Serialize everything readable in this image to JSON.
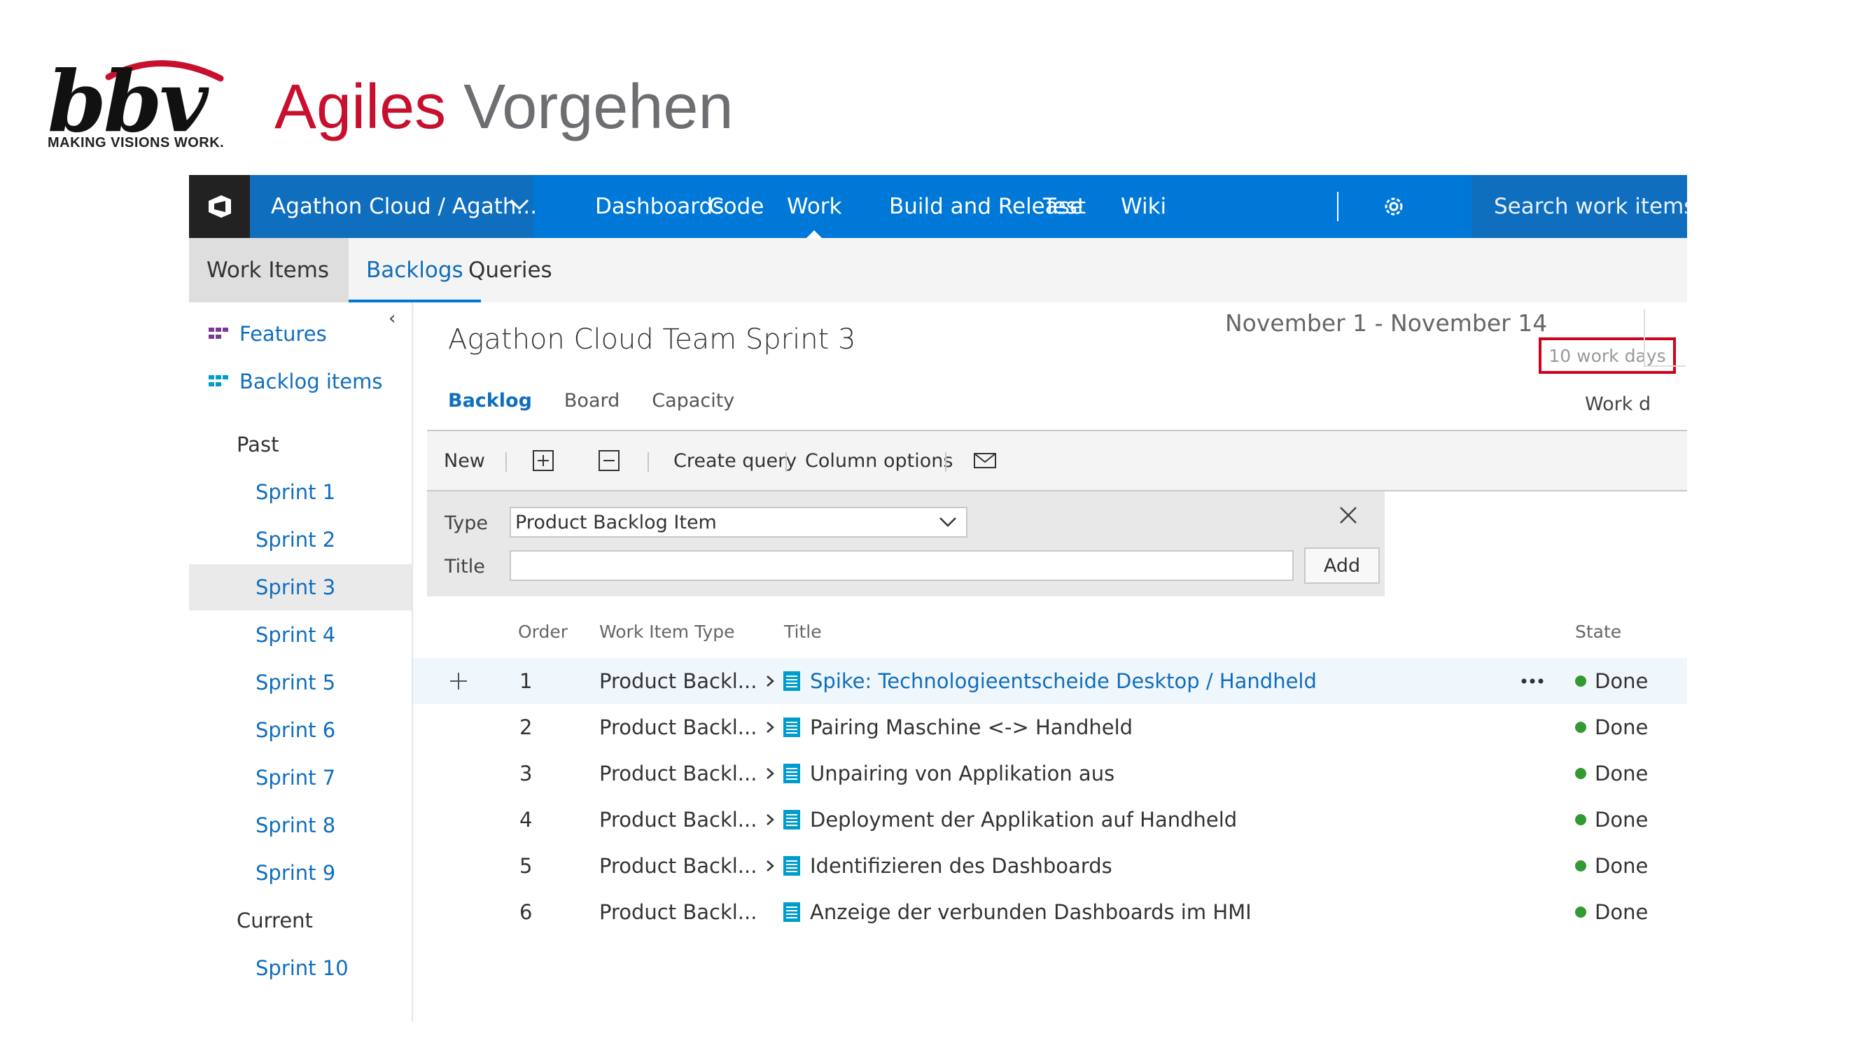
{
  "slide": {
    "logo": {
      "word": "bbv",
      "tagline": "MAKING VISIONS WORK.",
      "arc_color": "#c8102e"
    },
    "title_part1": "Agiles",
    "title_part2": "Vorgehen",
    "title_color1": "#c8102e",
    "title_color2": "#6d6e71"
  },
  "topbar": {
    "project": "Agathon Cloud / Agath...",
    "nav": [
      "Dashboards",
      "Code",
      "Work",
      "Build and Release",
      "Test",
      "Wiki"
    ],
    "active_nav": "Work",
    "search_placeholder": "Search work items i",
    "accent": "#0078d7"
  },
  "subnav": {
    "tabs": [
      "Work Items",
      "Backlogs",
      "Queries"
    ],
    "active": "Backlogs"
  },
  "sidebar": {
    "collapse_glyph": "‹",
    "top_items": [
      "Features",
      "Backlog items"
    ],
    "past_label": "Past",
    "past_sprints": [
      "Sprint 1",
      "Sprint 2",
      "Sprint 3",
      "Sprint 4",
      "Sprint 5",
      "Sprint 6",
      "Sprint 7",
      "Sprint 8",
      "Sprint 9"
    ],
    "selected_sprint": "Sprint 3",
    "current_label": "Current",
    "current_sprints": [
      "Sprint 10"
    ]
  },
  "sprint": {
    "title": "Agathon Cloud Team Sprint 3",
    "dates": "November 1 - November 14",
    "work_days": "10 work days",
    "work_detail_fragment": "Work d",
    "highlight_color": "#d0021b"
  },
  "pivots": [
    "Backlog",
    "Board",
    "Capacity"
  ],
  "toolbar": {
    "new_label": "New",
    "create_query": "Create query",
    "column_options": "Column options"
  },
  "add_panel": {
    "type_label": "Type",
    "type_value": "Product Backlog Item",
    "title_label": "Title",
    "title_value": "",
    "add_button": "Add"
  },
  "table": {
    "columns": [
      "Order",
      "Work Item Type",
      "Title",
      "State"
    ],
    "rows": [
      {
        "order": "1",
        "type": "Product Backl...",
        "title": "Spike: Technologieentscheide Desktop / Handheld",
        "state": "Done",
        "has_children": true
      },
      {
        "order": "2",
        "type": "Product Backl...",
        "title": "Pairing Maschine <-> Handheld",
        "state": "Done",
        "has_children": true
      },
      {
        "order": "3",
        "type": "Product Backl...",
        "title": "Unpairing von Applikation aus",
        "state": "Done",
        "has_children": true
      },
      {
        "order": "4",
        "type": "Product Backl...",
        "title": "Deployment der Applikation auf Handheld",
        "state": "Done",
        "has_children": true
      },
      {
        "order": "5",
        "type": "Product Backl...",
        "title": "Identifizieren des Dashboards",
        "state": "Done",
        "has_children": true
      },
      {
        "order": "6",
        "type": "Product Backl...",
        "title": "Anzeige der verbunden Dashboards im HMI",
        "state": "Done",
        "has_children": false
      }
    ],
    "row_icons": {
      "add": "plus-icon",
      "expand": "chevron-right-icon",
      "item": "backlog-item-icon",
      "more": "more-actions-icon"
    },
    "done_color": "#339933"
  }
}
